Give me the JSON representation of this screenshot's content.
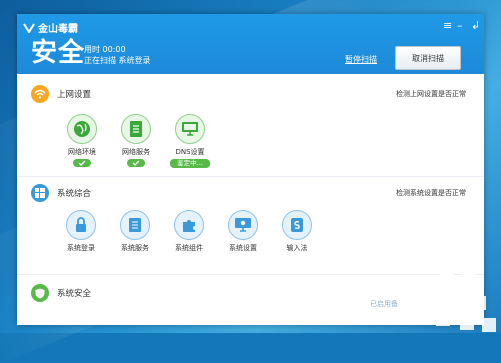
{
  "header": {
    "logo_text": "金山毒霸",
    "status": "安全",
    "elapsed_label": "用时 00:00",
    "scan_line_1": "正在扫描",
    "scan_line_2": "系统登录",
    "pause_label": "暂停扫描",
    "cancel_label": "取消扫描"
  },
  "window_controls": {
    "menu": "≡",
    "minimize": "–",
    "back": "↲"
  },
  "sections": {
    "network": {
      "title": "上网设置",
      "right_text": "检测上网设置是否正常",
      "items": [
        {
          "label": "网络环境",
          "status": "ok"
        },
        {
          "label": "网络服务",
          "status": "ok"
        },
        {
          "label": "DNS设置",
          "status_text": "鉴定中..."
        }
      ]
    },
    "system": {
      "title": "系统综合",
      "right_text": "检测系统设置是否正常",
      "items": [
        {
          "label": "系统登录"
        },
        {
          "label": "系统服务"
        },
        {
          "label": "系统组件"
        },
        {
          "label": "系统设置"
        },
        {
          "label": "输入法"
        }
      ]
    },
    "security": {
      "title": "系统安全"
    }
  },
  "footer": {
    "text": "已启用备"
  },
  "colors": {
    "header_blue": "#1f8fdf",
    "ok_green": "#56b948",
    "wifi_orange": "#f5a623",
    "section_blue": "#3a9ad9"
  }
}
